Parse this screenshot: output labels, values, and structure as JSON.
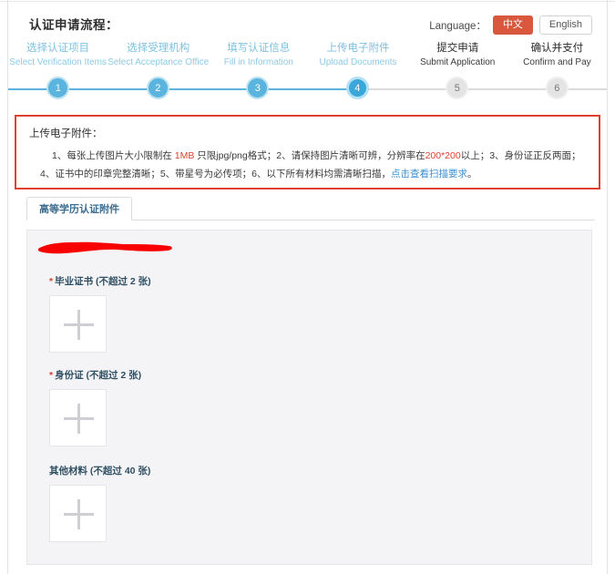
{
  "header": {
    "page_title": "认证申请流程：",
    "language_label": "Language：",
    "lang_cn": "中文",
    "lang_en": "English"
  },
  "stepper": {
    "steps": [
      {
        "num": "1",
        "cn": "选择认证项目",
        "en": "Select Verification Items",
        "state": "done"
      },
      {
        "num": "2",
        "cn": "选择受理机构",
        "en": "Select Acceptance Office",
        "state": "done"
      },
      {
        "num": "3",
        "cn": "填写认证信息",
        "en": "Fill in Information",
        "state": "done"
      },
      {
        "num": "4",
        "cn": "上传电子附件",
        "en": "Upload Documents",
        "state": "current"
      },
      {
        "num": "5",
        "cn": "提交申请",
        "en": "Submit Application",
        "state": "todo"
      },
      {
        "num": "6",
        "cn": "确认并支付",
        "en": "Confirm and Pay",
        "state": "todo"
      }
    ],
    "active_color": "#5ab4dd",
    "inactive_color": "#e4e4e4"
  },
  "notice": {
    "title": "上传电子附件：",
    "line1_a": "1、每张上传图片大小限制在 ",
    "line1_size": "1MB",
    "line1_b": " 只限jpg/png格式；2、请保持图片清晰可辨，分辨率在",
    "line1_res": "200*200",
    "line1_c": "以上；3、身份证正反两面；4、证书中的印章完整清晰；5、带星号为必传项；6、以下所有材料均需清晰扫描，",
    "line1_link": "点击查看扫描要求",
    "line1_d": "。",
    "border_color": "#e0402f"
  },
  "tabs": [
    {
      "label": "高等学历认证附件",
      "active": true
    }
  ],
  "upload_panel": {
    "groups": [
      {
        "required": true,
        "star": "*",
        "label": "毕业证书 (不超过 2 张)",
        "icon": "plus-icon"
      },
      {
        "required": true,
        "star": "*",
        "label": "身份证 (不超过 2 张)",
        "icon": "plus-icon"
      },
      {
        "required": false,
        "star": "",
        "label": "其他材料 (不超过 40 张)",
        "icon": "plus-icon"
      }
    ],
    "redaction_color": "#f80000",
    "panel_bg": "#f4f4f6"
  }
}
